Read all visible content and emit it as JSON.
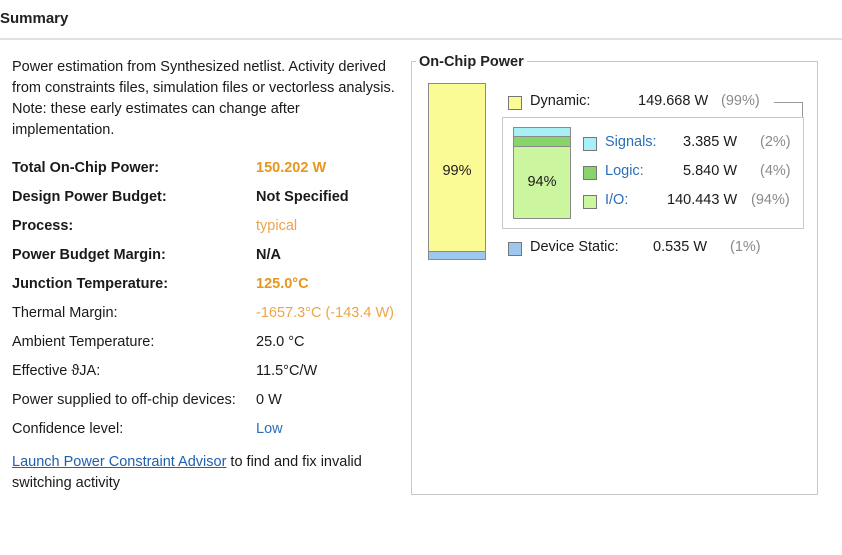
{
  "header": {
    "title": "Summary"
  },
  "intro": "Power estimation from Synthesized netlist. Activity derived from constraints files, simulation files or vectorless analysis. Note: these early estimates can change after implementation.",
  "summary_rows": [
    {
      "label": "Total On-Chip Power:",
      "value": "150.202 W"
    },
    {
      "label": "Design Power Budget:",
      "value": "Not Specified"
    },
    {
      "label": "Process:",
      "value": "typical"
    },
    {
      "label": "Power Budget Margin:",
      "value": "N/A"
    },
    {
      "label": "Junction Temperature:",
      "value": "125.0°C"
    },
    {
      "label": "Thermal Margin:",
      "value": "-1657.3°C (-143.4 W)"
    },
    {
      "label": "Ambient Temperature:",
      "value": "25.0 °C"
    },
    {
      "label": "Effective ϑJA:",
      "value": "11.5°C/W"
    },
    {
      "label": "Power supplied to off-chip devices:",
      "value": "0 W"
    },
    {
      "label": "Confidence level:",
      "value": "Low"
    }
  ],
  "advisor": {
    "link_text": "Launch Power Constraint Advisor",
    "rest_text": " to find and fix invalid switching activity"
  },
  "on_chip": {
    "title": "On-Chip Power",
    "main_bar_pct": "99%",
    "inner_bar_pct": "94%",
    "dynamic": {
      "label": "Dynamic:",
      "value": "149.668 W",
      "pct": "(99%)"
    },
    "signals": {
      "label": "Signals:",
      "value": "3.385 W",
      "pct": "(2%)"
    },
    "logic": {
      "label": "Logic:",
      "value": "5.840 W",
      "pct": "(4%)"
    },
    "io": {
      "label": "I/O:",
      "value": "140.443 W",
      "pct": "(94%)"
    },
    "device_static": {
      "label": "Device Static:",
      "value": "0.535 W",
      "pct": "(1%)"
    }
  },
  "colors": {
    "dynamic": "#fbfb95",
    "signals": "#a8f0f5",
    "logic": "#86d46a",
    "io": "#ccf5a0",
    "device_static": "#9cc8ef",
    "accent_orange": "#e8961e",
    "link_blue": "#1f5fb0"
  }
}
